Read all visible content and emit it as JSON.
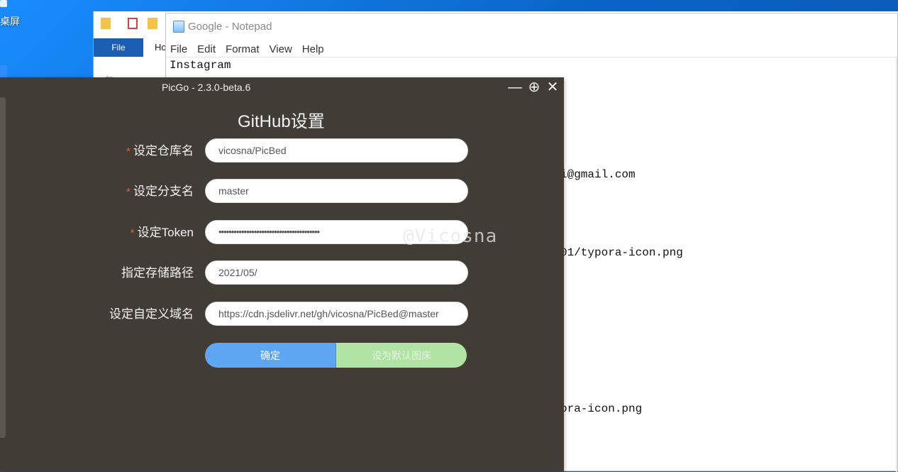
{
  "desktop": {
    "icon_label": "桌屏"
  },
  "explorer": {
    "file_tab": "File",
    "home_tab": "Ho"
  },
  "notepad": {
    "title": "Google - Notepad",
    "menu": [
      "File",
      "Edit",
      "Format",
      "View",
      "Help"
    ],
    "lines": {
      "line1": "Instagram",
      "line_email": "i@gmail.com",
      "line_icon1": "01/typora-icon.png",
      "line_icon2": "ora-icon.png"
    }
  },
  "picgo": {
    "window_title": "PicGo - 2.3.0-beta.6",
    "heading": "GitHub设置",
    "fields": [
      {
        "label": "设定仓库名",
        "required": "*",
        "value": "vicosna/PicBed"
      },
      {
        "label": "设定分支名",
        "required": "*",
        "value": "master"
      },
      {
        "label": "设定Token",
        "required": "*",
        "value": "••••••••••••••••••••••••••••••••••••••••"
      },
      {
        "label": "指定存储路径",
        "value": "2021/05/"
      },
      {
        "label": "设定自定义域名",
        "value": "https://cdn.jsdelivr.net/gh/vicosna/PicBed@master"
      }
    ],
    "buttons": {
      "confirm": "确定",
      "set_default": "设为默认图床"
    },
    "controls": {
      "minimize": "—",
      "maximize": "⊕",
      "close": "✕"
    }
  },
  "watermark": "@Vicosna"
}
